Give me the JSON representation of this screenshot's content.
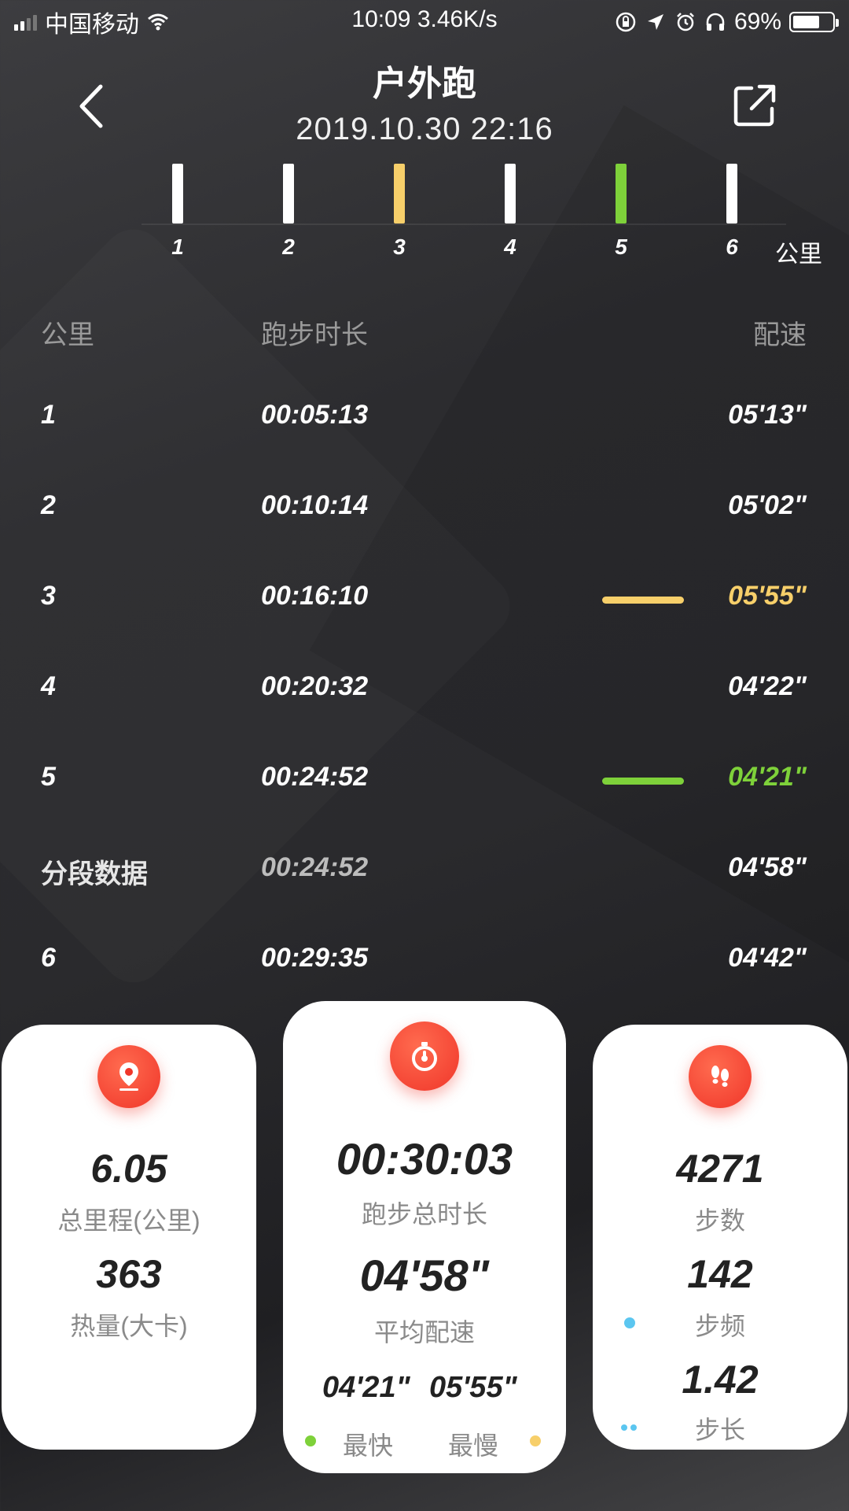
{
  "status_bar": {
    "carrier": "中国移动",
    "time_speed": "10:09 3.46K/s",
    "battery": "69%",
    "battery_level": 0.69
  },
  "header": {
    "title": "户外跑",
    "datetime": "2019.10.30 22:16",
    "back_icon": "chevron-left-icon",
    "share_icon": "share-icon"
  },
  "km_chart": {
    "labels": [
      "1",
      "2",
      "3",
      "4",
      "5",
      "6"
    ],
    "colors": [
      "#ffffff",
      "#ffffff",
      "#f7cf6a",
      "#ffffff",
      "#7ed13a",
      "#ffffff"
    ],
    "unit": "公里"
  },
  "table": {
    "headers": {
      "km": "公里",
      "duration": "跑步时长",
      "pace": "配速"
    },
    "rows": [
      {
        "km": "1",
        "time": "00:05:13",
        "pace": "05'13\"",
        "highlight": ""
      },
      {
        "km": "2",
        "time": "00:10:14",
        "pace": "05'02\"",
        "highlight": ""
      },
      {
        "km": "3",
        "time": "00:16:10",
        "pace": "05'55\"",
        "highlight": "slowest"
      },
      {
        "km": "4",
        "time": "00:20:32",
        "pace": "04'22\"",
        "highlight": ""
      },
      {
        "km": "5",
        "time": "00:24:52",
        "pace": "04'21\"",
        "highlight": "fastest"
      },
      {
        "km": "分段数据",
        "time": "00:24:52",
        "pace": "04'58\"",
        "highlight": "segment"
      },
      {
        "km": "6",
        "time": "00:29:35",
        "pace": "04'42\"",
        "highlight": ""
      }
    ],
    "colors": {
      "slowest": "#f7cf6a",
      "fastest": "#7ed13a"
    }
  },
  "cards": {
    "left": {
      "icon": "location-pin-icon",
      "distance": "6.05",
      "distance_label": "总里程(公里)",
      "calories": "363",
      "calories_label": "热量(大卡)"
    },
    "middle": {
      "icon": "stopwatch-icon",
      "total_time": "00:30:03",
      "total_time_label": "跑步总时长",
      "avg_pace": "04'58\"",
      "avg_pace_label": "平均配速",
      "fastest": "04'21\"",
      "slowest": "05'55\"",
      "fastest_label": "最快",
      "slowest_label": "最慢"
    },
    "right": {
      "icon": "footprints-icon",
      "steps": "4271",
      "steps_label": "步数",
      "cadence": "142",
      "cadence_label": "步频",
      "stride": "1.42",
      "stride_label": "步长"
    }
  }
}
